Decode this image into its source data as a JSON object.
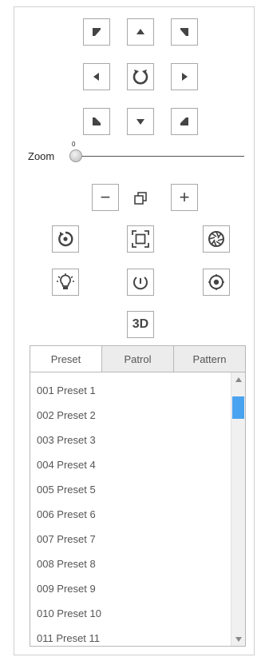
{
  "ptz": {
    "directions": [
      "up-left",
      "up",
      "up-right",
      "left",
      "auto-scan",
      "right",
      "down-left",
      "down",
      "down-right"
    ]
  },
  "zoom": {
    "label": "Zoom",
    "value": "0",
    "level": 0
  },
  "controls": {
    "zoom_out_symbol": "−",
    "zoom_in_symbol": "+",
    "three_d_label": "3D"
  },
  "tabs": [
    {
      "label": "Preset",
      "active": true
    },
    {
      "label": "Patrol",
      "active": false
    },
    {
      "label": "Pattern",
      "active": false
    }
  ],
  "presets": [
    "001  Preset 1",
    "002  Preset 2",
    "003  Preset 3",
    "004  Preset 4",
    "005  Preset 5",
    "006  Preset 6",
    "007  Preset 7",
    "008  Preset 8",
    "009  Preset 9",
    "010  Preset 10",
    "011  Preset 11"
  ],
  "colors": {
    "accent": "#4aa3f0",
    "border": "#a8a8a8",
    "text": "#555555"
  }
}
